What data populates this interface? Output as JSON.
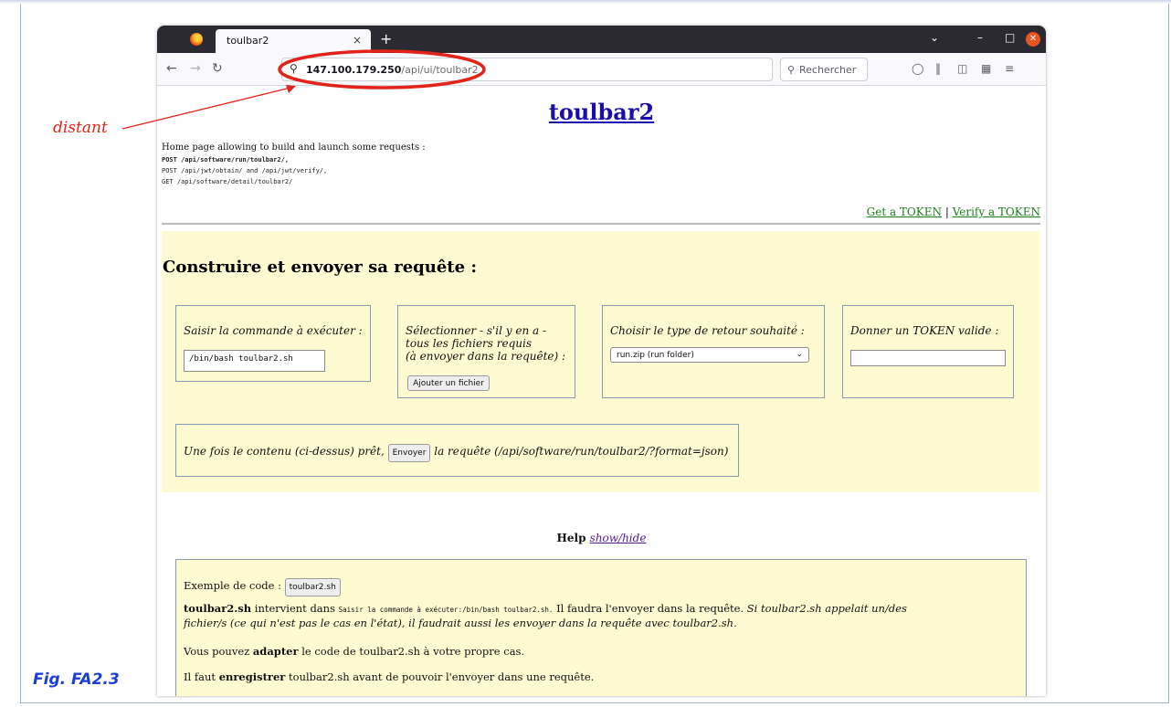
{
  "browser": {
    "tab_title": "toulbar2",
    "tab_close": "×",
    "new_tab": "+",
    "url_host": "147.100.179.250",
    "url_path": "/api/ui/toulbar2",
    "search_placeholder": "Rechercher"
  },
  "annotation": {
    "distant_label": "distant",
    "figure_caption": "Fig. FA2.3",
    "accent_color": "#e2231a"
  },
  "page": {
    "title": "toulbar2",
    "intro": "Home page allowing to build and launch some requests :",
    "endpoints": [
      "POST /api/software/run/toulbar2/,",
      "POST /api/jwt/obtain/ and /api/jwt/verify/,",
      "GET /api/software/detail/toulbar2/"
    ],
    "get_token": "Get a TOKEN",
    "separator": "|",
    "verify_token": "Verify a TOKEN"
  },
  "build": {
    "heading": "Construire et envoyer sa requête :",
    "command_label": "Saisir la commande à exécuter :",
    "command_value": "/bin/bash toulbar2.sh",
    "files_label_1": "Sélectionner - s'il y en a -",
    "files_label_2": "tous les fichiers requis",
    "files_label_3": "(à envoyer dans la requête) :",
    "add_file_button": "Ajouter un fichier",
    "return_label": "Choisir le type de retour souhaité :",
    "return_value": "run.zip (run folder)",
    "token_label": "Donner un TOKEN valide :",
    "token_value": "",
    "send_prefix": "Une fois le contenu (ci-dessus) prêt,",
    "send_button": "Envoyer",
    "send_suffix": "la requête (/api/software/run/toulbar2/?format=json)"
  },
  "help": {
    "title": "Help",
    "toggle": "show/hide",
    "example_label": "Exemple de code :",
    "example_button": "toulbar2.sh",
    "p1_bold": "toulbar2.sh",
    "p1_text1": "intervient dans",
    "p1_mono": "Saisir la commande à exécuter:/bin/bash toulbar2.sh.",
    "p1_text2": "Il faudra l'envoyer dans la requête.",
    "p1_italic_1": "Si toulbar2.sh appelait un/des",
    "p1_italic_2": "fichier/s (ce qui n'est pas le cas en l'état), il faudrait aussi les envoyer dans la requête avec toulbar2.sh.",
    "p2_text1": "Vous pouvez",
    "p2_bold": "adapter",
    "p2_text2": "le code de toulbar2.sh à votre propre cas.",
    "p3_text1": "Il faut",
    "p3_bold": "enregistrer",
    "p3_text2": "toulbar2.sh avant de pouvoir l'envoyer dans une requête."
  }
}
